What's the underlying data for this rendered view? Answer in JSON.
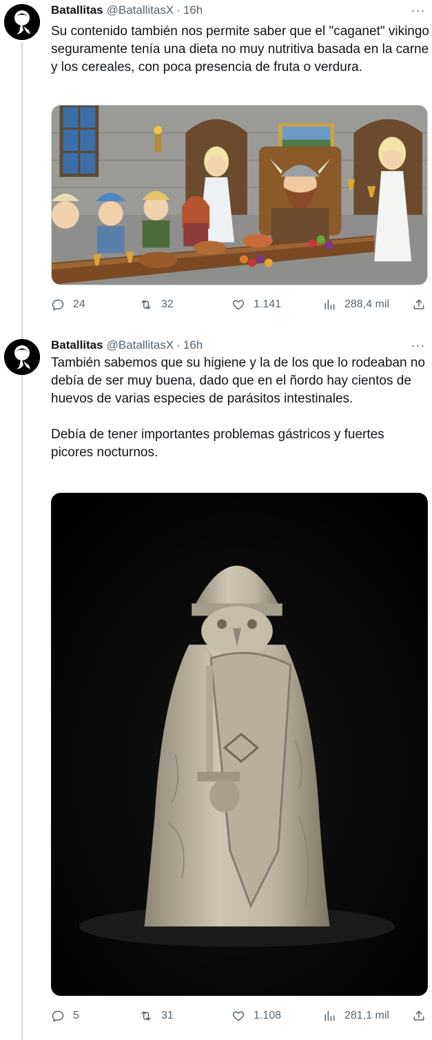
{
  "tweets": [
    {
      "author_name": "Batallitas",
      "author_handle": "@BatallitasX",
      "separator": "·",
      "time": "16h",
      "more_label": "···",
      "text_paragraphs": [
        "Su contenido también nos permite saber que el \"caganet\" vikingo seguramente tenía una dieta no muy nutritiva basada en la carne y los cereales, con poca presencia de fruta o verdura."
      ],
      "media_description": "cartoon-viking-feast-image",
      "replies": "24",
      "retweets": "32",
      "likes": "1.141",
      "views": "288,4 mil"
    },
    {
      "author_name": "Batallitas",
      "author_handle": "@BatallitasX",
      "separator": "·",
      "time": "16h",
      "more_label": "···",
      "text_paragraphs": [
        "También sabemos que su higiene y la de los que lo rodeaban no debía de ser muy buena, dado que  en el ñordo hay cientos de huevos de varias especies de parásitos intestinales.",
        "Debía de tener importantes problemas gástricos y fuertes picores nocturnos."
      ],
      "media_description": "lewis-chessman-warden-photo",
      "replies": "5",
      "retweets": "31",
      "likes": "1.108",
      "views": "281,1 mil"
    }
  ],
  "icons": {
    "reply": "reply-icon",
    "retweet": "retweet-icon",
    "like": "heart-icon",
    "views": "views-icon",
    "share": "share-icon"
  },
  "colors": {
    "text": "#0f1419",
    "muted": "#536471",
    "thread_line": "#cfd9de",
    "background": "#ffffff"
  }
}
